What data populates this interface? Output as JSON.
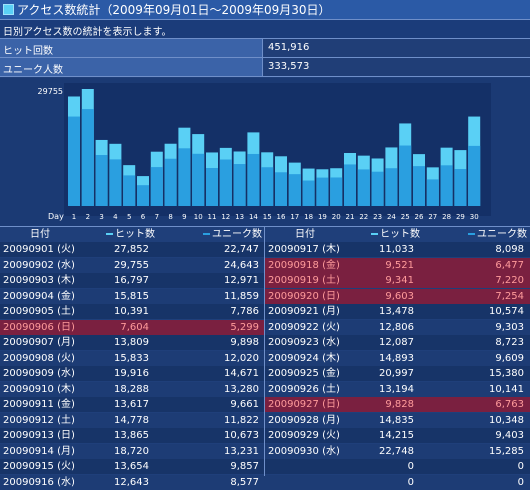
{
  "header": {
    "title": "アクセス数統計（2009年09月01日～2009年09月30日）"
  },
  "description": "日別アクセス数の統計を表示します。",
  "summary": [
    {
      "label": "ヒット回数",
      "value": "451,916"
    },
    {
      "label": "ユニーク人数",
      "value": "333,573"
    }
  ],
  "colors": {
    "hit": "#5ad0f5",
    "unique": "#2a9fe0",
    "highlight": "#7a2040"
  },
  "chart_data": {
    "type": "bar",
    "ymax_label": "29755",
    "xlabel": "Day",
    "categories": [
      "1",
      "2",
      "3",
      "4",
      "5",
      "6",
      "7",
      "8",
      "9",
      "10",
      "11",
      "12",
      "13",
      "14",
      "15",
      "16",
      "17",
      "18",
      "19",
      "20",
      "21",
      "22",
      "23",
      "24",
      "25",
      "26",
      "27",
      "28",
      "29",
      "30"
    ],
    "series": [
      {
        "name": "ヒット数",
        "values": [
          27852,
          29755,
          16797,
          15815,
          10391,
          7604,
          13809,
          15833,
          19916,
          18288,
          13617,
          14778,
          13865,
          18720,
          13654,
          12643,
          11033,
          9521,
          9341,
          9603,
          13478,
          12806,
          12087,
          14893,
          20997,
          13194,
          9828,
          14835,
          14215,
          22748
        ]
      },
      {
        "name": "ユニーク数",
        "values": [
          22747,
          24643,
          12971,
          11859,
          7786,
          5299,
          9898,
          12020,
          14671,
          13280,
          9661,
          11822,
          10673,
          13231,
          9857,
          8577,
          8098,
          6477,
          7220,
          7254,
          10574,
          9303,
          8723,
          9609,
          15380,
          10141,
          6763,
          10348,
          9403,
          15285
        ]
      }
    ]
  },
  "table": {
    "headers": {
      "date": "日付",
      "hit": "ヒット数",
      "unique": "ユニーク数"
    },
    "left": [
      {
        "date": "20090901 (火)",
        "hit": "27,852",
        "unique": "22,747",
        "hl": false
      },
      {
        "date": "20090902 (水)",
        "hit": "29,755",
        "unique": "24,643",
        "hl": false
      },
      {
        "date": "20090903 (木)",
        "hit": "16,797",
        "unique": "12,971",
        "hl": false
      },
      {
        "date": "20090904 (金)",
        "hit": "15,815",
        "unique": "11,859",
        "hl": false
      },
      {
        "date": "20090905 (土)",
        "hit": "10,391",
        "unique": "7,786",
        "hl": false
      },
      {
        "date": "20090906 (日)",
        "hit": "7,604",
        "unique": "5,299",
        "hl": true
      },
      {
        "date": "20090907 (月)",
        "hit": "13,809",
        "unique": "9,898",
        "hl": false
      },
      {
        "date": "20090908 (火)",
        "hit": "15,833",
        "unique": "12,020",
        "hl": false
      },
      {
        "date": "20090909 (水)",
        "hit": "19,916",
        "unique": "14,671",
        "hl": false
      },
      {
        "date": "20090910 (木)",
        "hit": "18,288",
        "unique": "13,280",
        "hl": false
      },
      {
        "date": "20090911 (金)",
        "hit": "13,617",
        "unique": "9,661",
        "hl": false
      },
      {
        "date": "20090912 (土)",
        "hit": "14,778",
        "unique": "11,822",
        "hl": false
      },
      {
        "date": "20090913 (日)",
        "hit": "13,865",
        "unique": "10,673",
        "hl": false
      },
      {
        "date": "20090914 (月)",
        "hit": "18,720",
        "unique": "13,231",
        "hl": false
      },
      {
        "date": "20090915 (火)",
        "hit": "13,654",
        "unique": "9,857",
        "hl": false
      },
      {
        "date": "20090916 (水)",
        "hit": "12,643",
        "unique": "8,577",
        "hl": false
      }
    ],
    "right": [
      {
        "date": "20090917 (木)",
        "hit": "11,033",
        "unique": "8,098",
        "hl": false
      },
      {
        "date": "20090918 (金)",
        "hit": "9,521",
        "unique": "6,477",
        "hl": true
      },
      {
        "date": "20090919 (土)",
        "hit": "9,341",
        "unique": "7,220",
        "hl": true
      },
      {
        "date": "20090920 (日)",
        "hit": "9,603",
        "unique": "7,254",
        "hl": true
      },
      {
        "date": "20090921 (月)",
        "hit": "13,478",
        "unique": "10,574",
        "hl": false
      },
      {
        "date": "20090922 (火)",
        "hit": "12,806",
        "unique": "9,303",
        "hl": false
      },
      {
        "date": "20090923 (水)",
        "hit": "12,087",
        "unique": "8,723",
        "hl": false
      },
      {
        "date": "20090924 (木)",
        "hit": "14,893",
        "unique": "9,609",
        "hl": false
      },
      {
        "date": "20090925 (金)",
        "hit": "20,997",
        "unique": "15,380",
        "hl": false
      },
      {
        "date": "20090926 (土)",
        "hit": "13,194",
        "unique": "10,141",
        "hl": false
      },
      {
        "date": "20090927 (日)",
        "hit": "9,828",
        "unique": "6,763",
        "hl": true
      },
      {
        "date": "20090928 (月)",
        "hit": "14,835",
        "unique": "10,348",
        "hl": false
      },
      {
        "date": "20090929 (火)",
        "hit": "14,215",
        "unique": "9,403",
        "hl": false
      },
      {
        "date": "20090930 (水)",
        "hit": "22,748",
        "unique": "15,285",
        "hl": false
      },
      {
        "date": "",
        "hit": "0",
        "unique": "0",
        "hl": false
      },
      {
        "date": "",
        "hit": "0",
        "unique": "0",
        "hl": false
      }
    ]
  }
}
